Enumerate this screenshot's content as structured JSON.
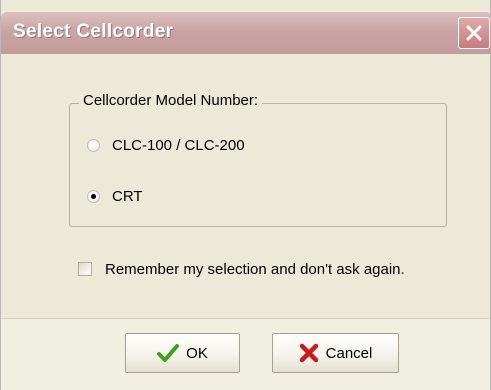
{
  "window": {
    "title": "Select Cellcorder"
  },
  "group": {
    "legend": "Cellcorder Model Number:",
    "options": [
      {
        "label": "CLC-100 / CLC-200",
        "selected": false
      },
      {
        "label": "CRT",
        "selected": true
      }
    ]
  },
  "remember": {
    "label": "Remember my selection and don't ask again.",
    "checked": false
  },
  "buttons": {
    "ok_label": "OK",
    "ok_icon": "checkmark-icon",
    "cancel_label": "Cancel",
    "cancel_icon": "x-mark-icon"
  },
  "colors": {
    "ok_icon": "#3aa31f",
    "cancel_icon": "#cc1a1a",
    "dialog_background": "#ece9d8"
  }
}
